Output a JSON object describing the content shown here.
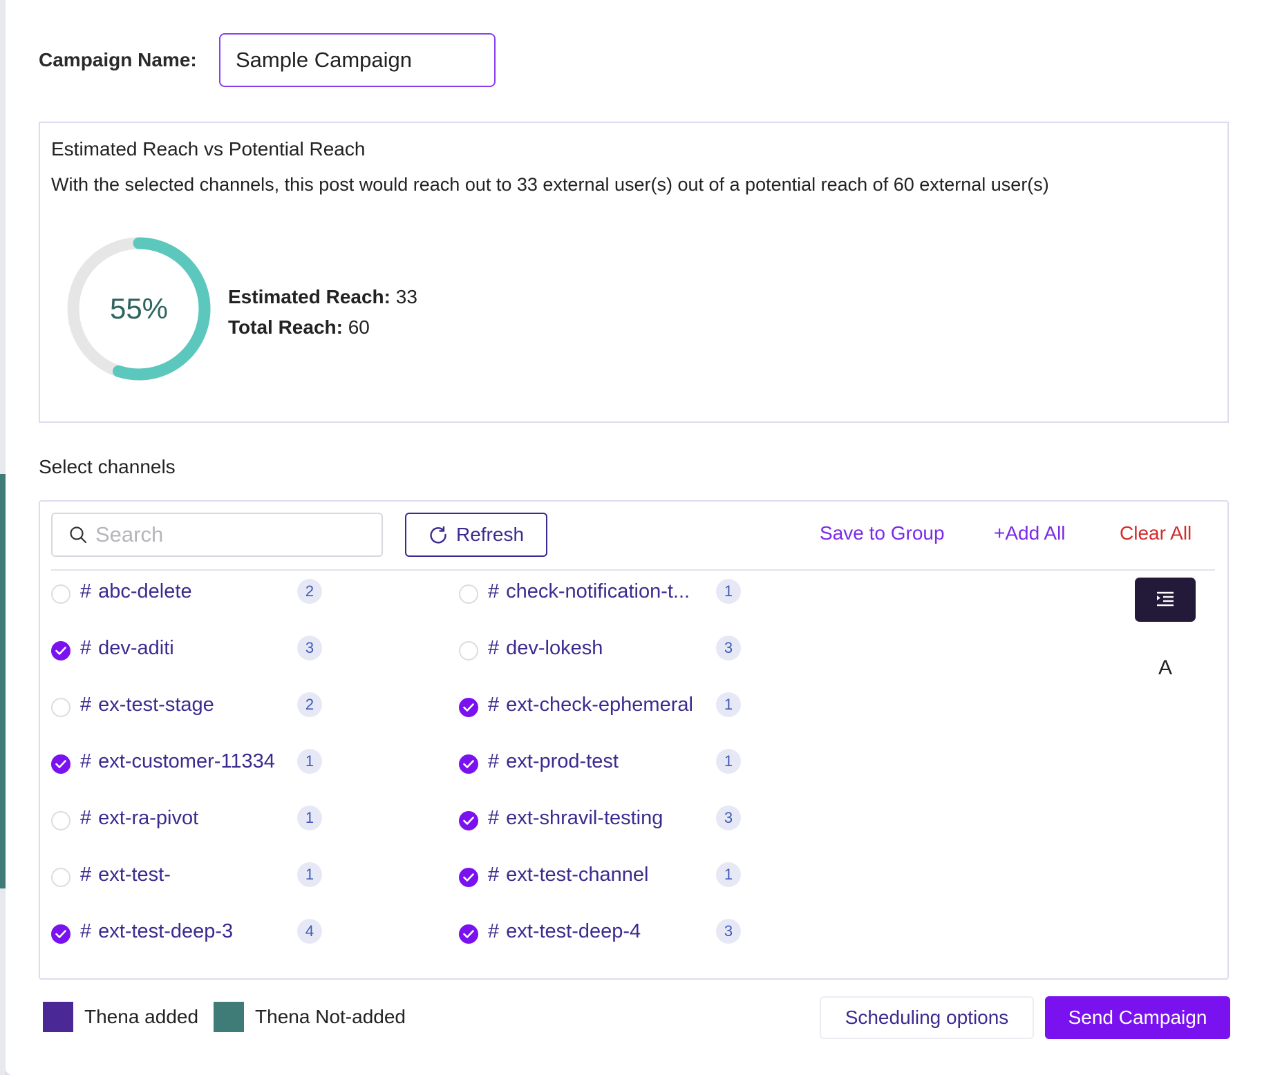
{
  "campaign": {
    "label": "Campaign Name:",
    "value": "Sample Campaign"
  },
  "reach": {
    "title": "Estimated Reach vs Potential Reach",
    "description": "With the selected channels, this post would reach out to 33 external user(s) out of a potential reach of 60 external user(s)",
    "percent_label": "55%",
    "percent_value": 55,
    "estimated_label": "Estimated Reach:",
    "estimated_value": "33",
    "total_label": "Total Reach:",
    "total_value": "60",
    "colors": {
      "fill": "#5cc7bd",
      "track": "#e6e6e6"
    }
  },
  "channels": {
    "title": "Select channels",
    "search_placeholder": "Search",
    "refresh_label": "Refresh",
    "save_group_label": "Save to Group",
    "add_all_label": "+Add All",
    "clear_all_label": "Clear All",
    "side_letter": "A",
    "left": [
      {
        "name": "abc-delete",
        "count": "2",
        "checked": false
      },
      {
        "name": "dev-aditi",
        "count": "3",
        "checked": true
      },
      {
        "name": "ex-test-stage",
        "count": "2",
        "checked": false
      },
      {
        "name": "ext-customer-11334",
        "count": "1",
        "checked": true
      },
      {
        "name": "ext-ra-pivot",
        "count": "1",
        "checked": false
      },
      {
        "name": "ext-test-",
        "count": "1",
        "checked": false
      },
      {
        "name": "ext-test-deep-3",
        "count": "4",
        "checked": true
      }
    ],
    "right": [
      {
        "name": "check-notification-t...",
        "count": "1",
        "checked": false
      },
      {
        "name": "dev-lokesh",
        "count": "3",
        "checked": false
      },
      {
        "name": "ext-check-ephemeral",
        "count": "1",
        "checked": true
      },
      {
        "name": "ext-prod-test",
        "count": "1",
        "checked": true
      },
      {
        "name": "ext-shravil-testing",
        "count": "3",
        "checked": true
      },
      {
        "name": "ext-test-channel",
        "count": "1",
        "checked": true
      },
      {
        "name": "ext-test-deep-4",
        "count": "3",
        "checked": true
      }
    ]
  },
  "legend": {
    "added_label": "Thena added",
    "not_added_label": "Thena Not-added",
    "added_color": "#4a2896",
    "not_added_color": "#3f7c78"
  },
  "footer": {
    "scheduling_label": "Scheduling options",
    "send_label": "Send Campaign"
  }
}
